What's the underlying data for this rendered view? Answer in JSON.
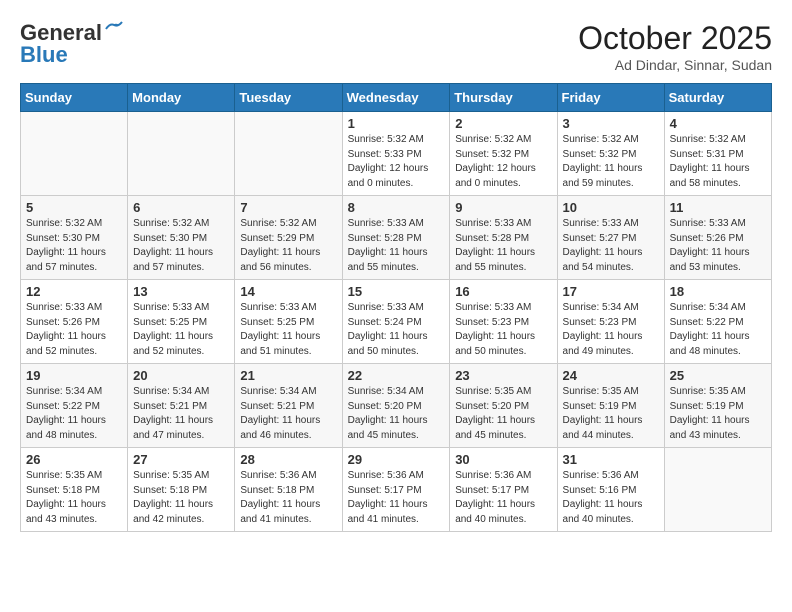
{
  "logo": {
    "line1": "General",
    "line2": "Blue"
  },
  "header": {
    "month": "October 2025",
    "location": "Ad Dindar, Sinnar, Sudan"
  },
  "weekdays": [
    "Sunday",
    "Monday",
    "Tuesday",
    "Wednesday",
    "Thursday",
    "Friday",
    "Saturday"
  ],
  "weeks": [
    [
      {
        "day": "",
        "sunrise": "",
        "sunset": "",
        "daylight": "",
        "empty": true
      },
      {
        "day": "",
        "sunrise": "",
        "sunset": "",
        "daylight": "",
        "empty": true
      },
      {
        "day": "",
        "sunrise": "",
        "sunset": "",
        "daylight": "",
        "empty": true
      },
      {
        "day": "1",
        "sunrise": "Sunrise: 5:32 AM",
        "sunset": "Sunset: 5:33 PM",
        "daylight": "Daylight: 12 hours and 0 minutes."
      },
      {
        "day": "2",
        "sunrise": "Sunrise: 5:32 AM",
        "sunset": "Sunset: 5:32 PM",
        "daylight": "Daylight: 12 hours and 0 minutes."
      },
      {
        "day": "3",
        "sunrise": "Sunrise: 5:32 AM",
        "sunset": "Sunset: 5:32 PM",
        "daylight": "Daylight: 11 hours and 59 minutes."
      },
      {
        "day": "4",
        "sunrise": "Sunrise: 5:32 AM",
        "sunset": "Sunset: 5:31 PM",
        "daylight": "Daylight: 11 hours and 58 minutes."
      }
    ],
    [
      {
        "day": "5",
        "sunrise": "Sunrise: 5:32 AM",
        "sunset": "Sunset: 5:30 PM",
        "daylight": "Daylight: 11 hours and 57 minutes."
      },
      {
        "day": "6",
        "sunrise": "Sunrise: 5:32 AM",
        "sunset": "Sunset: 5:30 PM",
        "daylight": "Daylight: 11 hours and 57 minutes."
      },
      {
        "day": "7",
        "sunrise": "Sunrise: 5:32 AM",
        "sunset": "Sunset: 5:29 PM",
        "daylight": "Daylight: 11 hours and 56 minutes."
      },
      {
        "day": "8",
        "sunrise": "Sunrise: 5:33 AM",
        "sunset": "Sunset: 5:28 PM",
        "daylight": "Daylight: 11 hours and 55 minutes."
      },
      {
        "day": "9",
        "sunrise": "Sunrise: 5:33 AM",
        "sunset": "Sunset: 5:28 PM",
        "daylight": "Daylight: 11 hours and 55 minutes."
      },
      {
        "day": "10",
        "sunrise": "Sunrise: 5:33 AM",
        "sunset": "Sunset: 5:27 PM",
        "daylight": "Daylight: 11 hours and 54 minutes."
      },
      {
        "day": "11",
        "sunrise": "Sunrise: 5:33 AM",
        "sunset": "Sunset: 5:26 PM",
        "daylight": "Daylight: 11 hours and 53 minutes."
      }
    ],
    [
      {
        "day": "12",
        "sunrise": "Sunrise: 5:33 AM",
        "sunset": "Sunset: 5:26 PM",
        "daylight": "Daylight: 11 hours and 52 minutes."
      },
      {
        "day": "13",
        "sunrise": "Sunrise: 5:33 AM",
        "sunset": "Sunset: 5:25 PM",
        "daylight": "Daylight: 11 hours and 52 minutes."
      },
      {
        "day": "14",
        "sunrise": "Sunrise: 5:33 AM",
        "sunset": "Sunset: 5:25 PM",
        "daylight": "Daylight: 11 hours and 51 minutes."
      },
      {
        "day": "15",
        "sunrise": "Sunrise: 5:33 AM",
        "sunset": "Sunset: 5:24 PM",
        "daylight": "Daylight: 11 hours and 50 minutes."
      },
      {
        "day": "16",
        "sunrise": "Sunrise: 5:33 AM",
        "sunset": "Sunset: 5:23 PM",
        "daylight": "Daylight: 11 hours and 50 minutes."
      },
      {
        "day": "17",
        "sunrise": "Sunrise: 5:34 AM",
        "sunset": "Sunset: 5:23 PM",
        "daylight": "Daylight: 11 hours and 49 minutes."
      },
      {
        "day": "18",
        "sunrise": "Sunrise: 5:34 AM",
        "sunset": "Sunset: 5:22 PM",
        "daylight": "Daylight: 11 hours and 48 minutes."
      }
    ],
    [
      {
        "day": "19",
        "sunrise": "Sunrise: 5:34 AM",
        "sunset": "Sunset: 5:22 PM",
        "daylight": "Daylight: 11 hours and 48 minutes."
      },
      {
        "day": "20",
        "sunrise": "Sunrise: 5:34 AM",
        "sunset": "Sunset: 5:21 PM",
        "daylight": "Daylight: 11 hours and 47 minutes."
      },
      {
        "day": "21",
        "sunrise": "Sunrise: 5:34 AM",
        "sunset": "Sunset: 5:21 PM",
        "daylight": "Daylight: 11 hours and 46 minutes."
      },
      {
        "day": "22",
        "sunrise": "Sunrise: 5:34 AM",
        "sunset": "Sunset: 5:20 PM",
        "daylight": "Daylight: 11 hours and 45 minutes."
      },
      {
        "day": "23",
        "sunrise": "Sunrise: 5:35 AM",
        "sunset": "Sunset: 5:20 PM",
        "daylight": "Daylight: 11 hours and 45 minutes."
      },
      {
        "day": "24",
        "sunrise": "Sunrise: 5:35 AM",
        "sunset": "Sunset: 5:19 PM",
        "daylight": "Daylight: 11 hours and 44 minutes."
      },
      {
        "day": "25",
        "sunrise": "Sunrise: 5:35 AM",
        "sunset": "Sunset: 5:19 PM",
        "daylight": "Daylight: 11 hours and 43 minutes."
      }
    ],
    [
      {
        "day": "26",
        "sunrise": "Sunrise: 5:35 AM",
        "sunset": "Sunset: 5:18 PM",
        "daylight": "Daylight: 11 hours and 43 minutes."
      },
      {
        "day": "27",
        "sunrise": "Sunrise: 5:35 AM",
        "sunset": "Sunset: 5:18 PM",
        "daylight": "Daylight: 11 hours and 42 minutes."
      },
      {
        "day": "28",
        "sunrise": "Sunrise: 5:36 AM",
        "sunset": "Sunset: 5:18 PM",
        "daylight": "Daylight: 11 hours and 41 minutes."
      },
      {
        "day": "29",
        "sunrise": "Sunrise: 5:36 AM",
        "sunset": "Sunset: 5:17 PM",
        "daylight": "Daylight: 11 hours and 41 minutes."
      },
      {
        "day": "30",
        "sunrise": "Sunrise: 5:36 AM",
        "sunset": "Sunset: 5:17 PM",
        "daylight": "Daylight: 11 hours and 40 minutes."
      },
      {
        "day": "31",
        "sunrise": "Sunrise: 5:36 AM",
        "sunset": "Sunset: 5:16 PM",
        "daylight": "Daylight: 11 hours and 40 minutes."
      },
      {
        "day": "",
        "sunrise": "",
        "sunset": "",
        "daylight": "",
        "empty": true
      }
    ]
  ]
}
